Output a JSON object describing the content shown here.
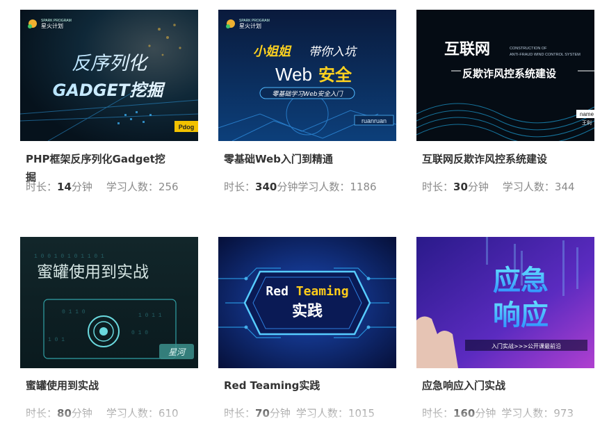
{
  "units": {
    "duration_label": "时长：",
    "minutes_unit": "分钟",
    "learners_label": "学习人数："
  },
  "courses": [
    {
      "title": "PHP框架反序列化Gadget挖掘",
      "duration": "14",
      "learners": "256",
      "thumb": {
        "logo": "星火计划",
        "logo_sub": "SPARK PROGRAM",
        "line1": "反序列化",
        "line2": "GADGET挖掘",
        "corner": "Pdog"
      }
    },
    {
      "title": "零基础Web入门到精通",
      "duration": "340",
      "learners": "1186",
      "thumb": {
        "logo": "星火计划",
        "logo_sub": "SPARK PROGRAM",
        "line1a": "小姐姐",
        "line1b": "带你入坑",
        "line2a": "Web",
        "line2b": "安全",
        "banner": "零基础学习Web安全入门",
        "author": "ruanruan"
      }
    },
    {
      "title": "互联网反欺诈风控系统建设",
      "duration": "30",
      "learners": "344",
      "thumb": {
        "line1": "互联网",
        "en1": "CONSTRUCTION OF",
        "en2": "ANTI-FRAUD WIND CONTROL SYSTEM",
        "line2": "反欺诈风控系统建设",
        "name_label": "name",
        "author": "王利"
      }
    },
    {
      "title": "蜜罐使用到实战",
      "duration": "80",
      "learners": "610",
      "thumb": {
        "line1": "蜜罐使用到实战",
        "badge": "星河"
      }
    },
    {
      "title": "Red Teaming实践",
      "duration": "70",
      "learners": "1015",
      "thumb": {
        "line1a": "Red ",
        "line1b": "Teaming",
        "line2": "实践"
      }
    },
    {
      "title": "应急响应入门实战",
      "duration": "160",
      "learners": "973",
      "thumb": {
        "line1": "应急",
        "line2": "响应",
        "tag": "入门实战>>>公开课最前沿"
      }
    }
  ]
}
